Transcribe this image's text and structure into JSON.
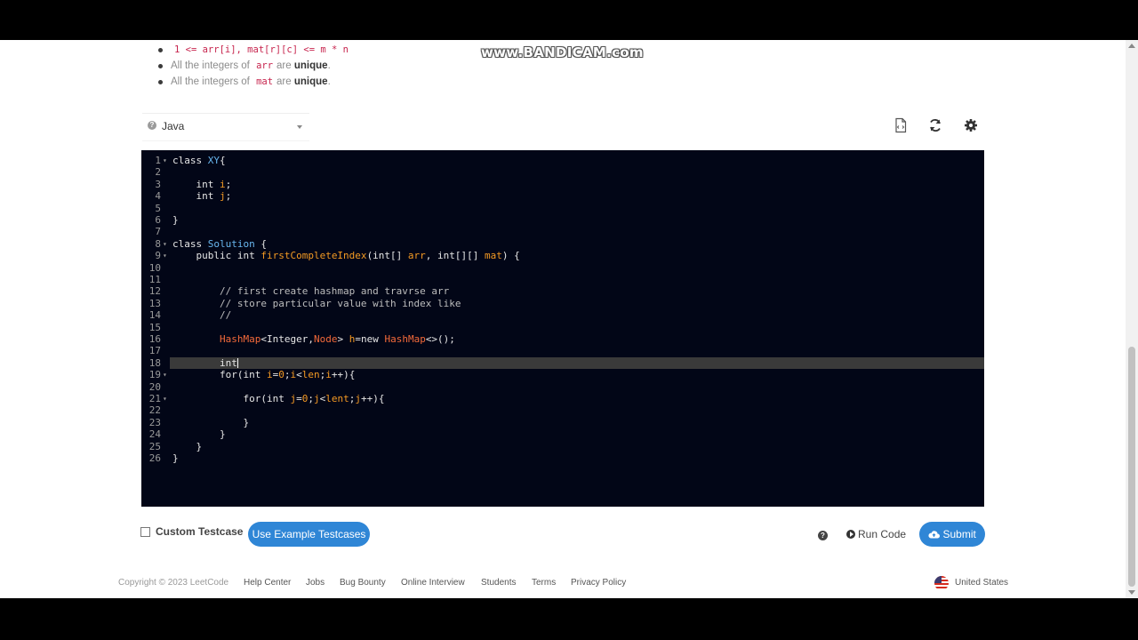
{
  "watermark": "www.BANDICAM.com",
  "constraints": {
    "c1_code": "1 <= arr[i], mat[r][c] <= m * n",
    "c2_prefix": "All the integers of",
    "c2_code": "arr",
    "c2_mid": "are",
    "c2_bold": "unique",
    "c2_suffix": ".",
    "c3_prefix": "All the integers of",
    "c3_code": "mat",
    "c3_mid": "are",
    "c3_bold": "unique",
    "c3_suffix": "."
  },
  "toolbar": {
    "language": "Java",
    "icons": [
      "document-icon",
      "refresh-icon",
      "settings-icon"
    ]
  },
  "editor": {
    "active_line": 18,
    "lines": [
      {
        "n": "1",
        "fold": "▾",
        "tokens": [
          [
            "kw",
            "class "
          ],
          [
            "cl",
            "XY"
          ],
          [
            "kw",
            "{"
          ]
        ]
      },
      {
        "n": "2",
        "fold": "",
        "tokens": []
      },
      {
        "n": "3",
        "fold": "",
        "tokens": [
          [
            "kw",
            "    int "
          ],
          [
            "va",
            "i"
          ],
          [
            "kw",
            ";"
          ]
        ]
      },
      {
        "n": "4",
        "fold": "",
        "tokens": [
          [
            "kw",
            "    int "
          ],
          [
            "va",
            "j"
          ],
          [
            "kw",
            ";"
          ]
        ]
      },
      {
        "n": "5",
        "fold": "",
        "tokens": []
      },
      {
        "n": "6",
        "fold": "",
        "tokens": [
          [
            "kw",
            "}"
          ]
        ]
      },
      {
        "n": "7",
        "fold": "",
        "tokens": []
      },
      {
        "n": "8",
        "fold": "▾",
        "tokens": [
          [
            "kw",
            "class "
          ],
          [
            "cl",
            "Solution"
          ],
          [
            "kw",
            " {"
          ]
        ]
      },
      {
        "n": "9",
        "fold": "▾",
        "tokens": [
          [
            "kw",
            "    public int "
          ],
          [
            "va",
            "firstCompleteIndex"
          ],
          [
            "kw",
            "(int[] "
          ],
          [
            "va",
            "arr"
          ],
          [
            "kw",
            ", int[][] "
          ],
          [
            "va",
            "mat"
          ],
          [
            "kw",
            ") {"
          ]
        ]
      },
      {
        "n": "10",
        "fold": "",
        "tokens": []
      },
      {
        "n": "11",
        "fold": "",
        "tokens": []
      },
      {
        "n": "12",
        "fold": "",
        "tokens": [
          [
            "cm",
            "        // first create hashmap and travrse arr"
          ]
        ]
      },
      {
        "n": "13",
        "fold": "",
        "tokens": [
          [
            "cm",
            "        // store particular value with index like"
          ]
        ]
      },
      {
        "n": "14",
        "fold": "",
        "tokens": [
          [
            "cm",
            "        //"
          ]
        ]
      },
      {
        "n": "15",
        "fold": "",
        "tokens": []
      },
      {
        "n": "16",
        "fold": "",
        "tokens": [
          [
            "ty",
            "        HashMap"
          ],
          [
            "kw",
            "<Integer,"
          ],
          [
            "ty",
            "Node"
          ],
          [
            "kw",
            "> "
          ],
          [
            "va",
            "h"
          ],
          [
            "kw",
            "=new "
          ],
          [
            "ty",
            "HashMap"
          ],
          [
            "kw",
            "<>();"
          ]
        ]
      },
      {
        "n": "17",
        "fold": "",
        "tokens": []
      },
      {
        "n": "18",
        "fold": "",
        "tokens": [
          [
            "kw",
            "        int"
          ]
        ]
      },
      {
        "n": "19",
        "fold": "▾",
        "tokens": [
          [
            "kw",
            "        for(int "
          ],
          [
            "va",
            "i"
          ],
          [
            "kw",
            "="
          ],
          [
            "va",
            "0"
          ],
          [
            "kw",
            ";"
          ],
          [
            "va",
            "i"
          ],
          [
            "kw",
            "<"
          ],
          [
            "va",
            "len"
          ],
          [
            "kw",
            ";"
          ],
          [
            "va",
            "i"
          ],
          [
            "kw",
            "++){"
          ]
        ]
      },
      {
        "n": "20",
        "fold": "",
        "tokens": []
      },
      {
        "n": "21",
        "fold": "▾",
        "tokens": [
          [
            "kw",
            "            for(int "
          ],
          [
            "va",
            "j"
          ],
          [
            "kw",
            "="
          ],
          [
            "va",
            "0"
          ],
          [
            "kw",
            ";"
          ],
          [
            "va",
            "j"
          ],
          [
            "kw",
            "<"
          ],
          [
            "va",
            "lent"
          ],
          [
            "kw",
            ";"
          ],
          [
            "va",
            "j"
          ],
          [
            "kw",
            "++){"
          ]
        ]
      },
      {
        "n": "22",
        "fold": "",
        "tokens": []
      },
      {
        "n": "23",
        "fold": "",
        "tokens": [
          [
            "kw",
            "            }"
          ]
        ]
      },
      {
        "n": "24",
        "fold": "",
        "tokens": [
          [
            "kw",
            "        }"
          ]
        ]
      },
      {
        "n": "25",
        "fold": "",
        "tokens": [
          [
            "kw",
            "    }"
          ]
        ]
      },
      {
        "n": "26",
        "fold": "",
        "tokens": [
          [
            "kw",
            "}"
          ]
        ]
      }
    ]
  },
  "actions": {
    "custom_testcase": "Custom Testcase",
    "use_example": "Use Example Testcases",
    "run_code": "Run Code",
    "submit": "Submit"
  },
  "footer": {
    "copyright": "Copyright © 2023 LeetCode",
    "links": [
      "Help Center",
      "Jobs",
      "Bug Bounty",
      "Online Interview",
      "Students",
      "Terms",
      "Privacy Policy"
    ],
    "country": "United States"
  }
}
